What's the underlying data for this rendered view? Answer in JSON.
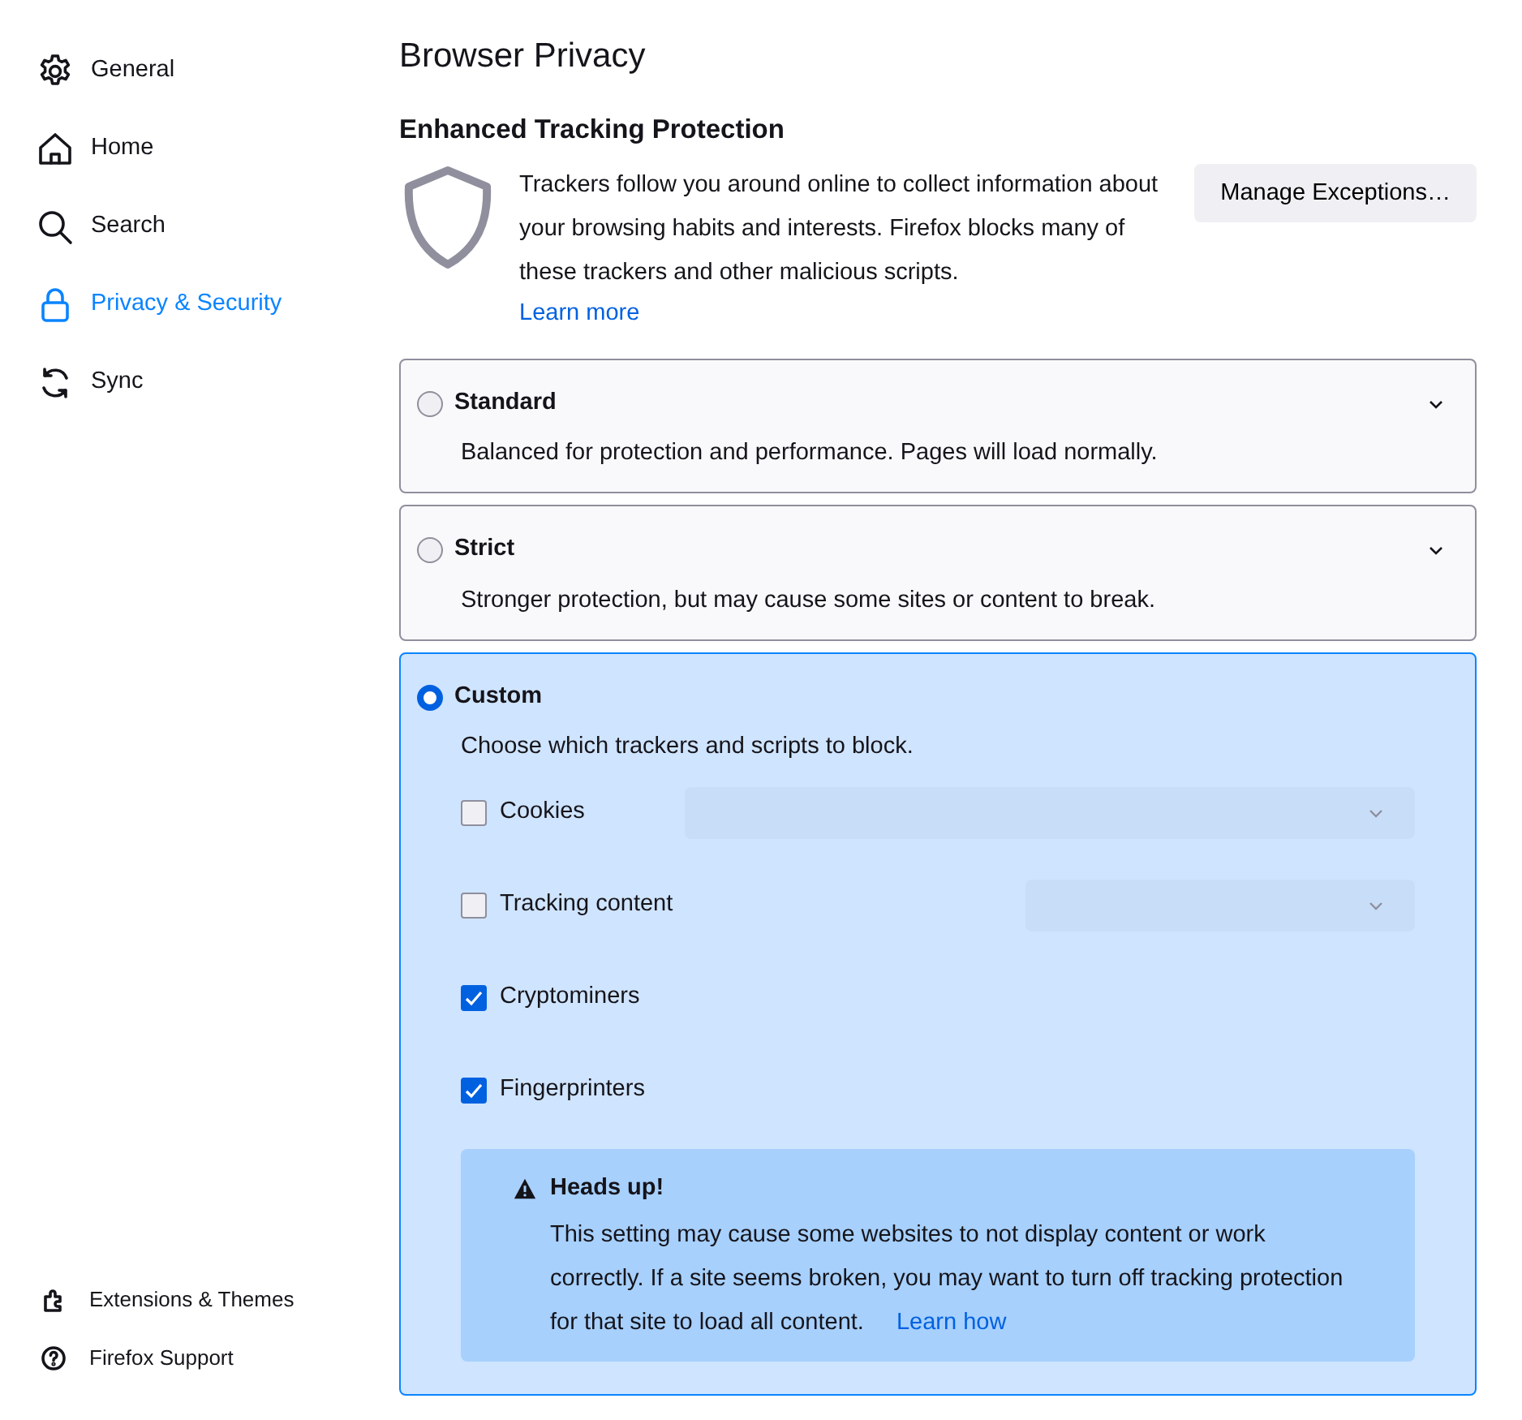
{
  "sidebar": {
    "items": [
      {
        "label": "General",
        "selected": false
      },
      {
        "label": "Home",
        "selected": false
      },
      {
        "label": "Search",
        "selected": false
      },
      {
        "label": "Privacy & Security",
        "selected": true
      },
      {
        "label": "Sync",
        "selected": false
      }
    ],
    "footer": [
      {
        "label": "Extensions & Themes"
      },
      {
        "label": "Firefox Support"
      }
    ]
  },
  "page_title": "Browser Privacy",
  "section": {
    "title": "Enhanced Tracking Protection",
    "description": "Trackers follow you around online to collect information about your browsing habits and interests. Firefox blocks many of these trackers and other malicious scripts.",
    "learn_more": "Learn more",
    "button": "Manage Exceptions…",
    "modes": [
      {
        "label": "Standard",
        "description": "Balanced for protection and performance. Pages will load normally.",
        "selected": false
      },
      {
        "label": "Strict",
        "description": "Stronger protection, but may cause some sites or content to break.",
        "selected": false
      },
      {
        "label": "Custom",
        "description": "Choose which trackers and scripts to block.",
        "selected": true,
        "options": [
          {
            "label": "Cookies",
            "checked": false,
            "kind": "select"
          },
          {
            "label": "Tracking content",
            "checked": false,
            "kind": "select"
          },
          {
            "label": "Cryptominers",
            "checked": true,
            "kind": "checkbox"
          },
          {
            "label": "Fingerprinters",
            "checked": true,
            "kind": "checkbox"
          }
        ],
        "warning": {
          "title": "Heads up!",
          "text": "This setting may cause some websites to not display content or work correctly. If a site seems broken, you may want to turn off tracking protection for that site to load all content.",
          "link": "Learn how"
        }
      }
    ]
  }
}
